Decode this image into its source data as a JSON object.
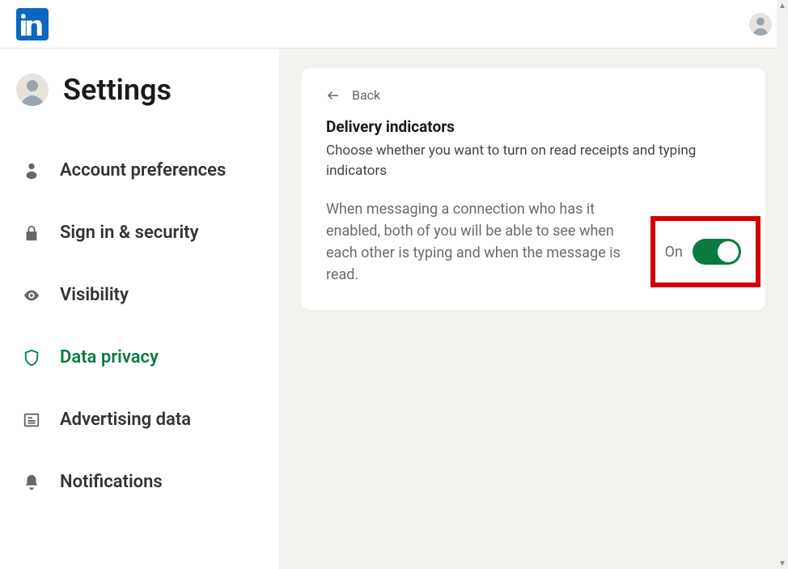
{
  "header": {
    "brand_name": "LinkedIn"
  },
  "sidebar": {
    "title": "Settings",
    "items": [
      {
        "label": "Account preferences",
        "icon": "person"
      },
      {
        "label": "Sign in & security",
        "icon": "lock"
      },
      {
        "label": "Visibility",
        "icon": "eye"
      },
      {
        "label": "Data privacy",
        "icon": "shield",
        "active": true
      },
      {
        "label": "Advertising data",
        "icon": "newspaper"
      },
      {
        "label": "Notifications",
        "icon": "bell"
      }
    ]
  },
  "main": {
    "back_label": "Back",
    "title": "Delivery indicators",
    "subtitle": "Choose whether you want to turn on read receipts and typing indicators",
    "toggle_description": "When messaging a connection who has it enabled, both of you will be able to see when each other is typing and when the message is read.",
    "toggle_state_label": "On",
    "toggle_on": true
  }
}
